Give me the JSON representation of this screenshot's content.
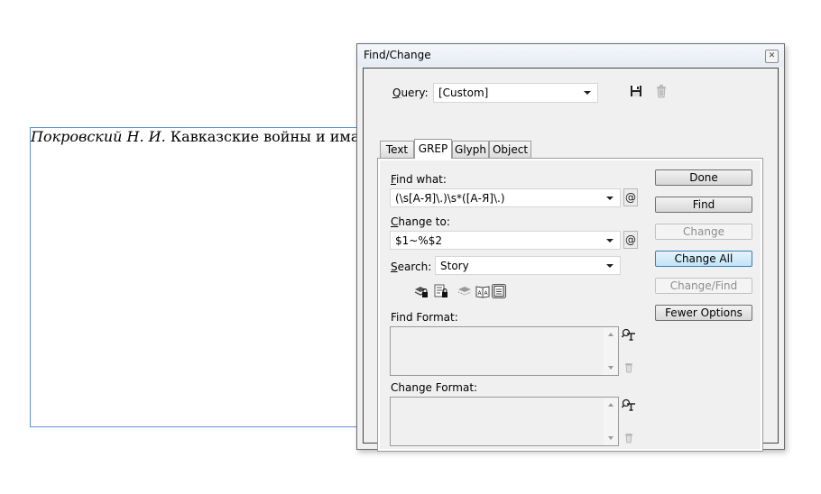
{
  "document": {
    "text_italic": "Покровский Н. И.",
    "text_regular": " Кавказские войны и имам"
  },
  "dialog": {
    "title": "Find/Change",
    "close_icon": "close-icon",
    "query": {
      "label_u": "Q",
      "label_rest": "uery:",
      "value": "[Custom]",
      "save_icon": "floppy-disk-icon",
      "delete_icon": "trash-icon"
    },
    "tabs": [
      {
        "label": "Text",
        "active": false
      },
      {
        "label": "GREP",
        "active": true
      },
      {
        "label": "Glyph",
        "active": false
      },
      {
        "label": "Object",
        "active": false
      }
    ],
    "find_what": {
      "label_u": "F",
      "label_rest": "ind what:",
      "value": "(\\s[А-Я]\\.)\\s*([А-Я]\\.)",
      "special_icon": "@"
    },
    "change_to": {
      "label_u": "C",
      "label_rest": "hange to:",
      "value": "$1~%$2",
      "special_icon": "@"
    },
    "search": {
      "label_u": "S",
      "label_rest": "earch:",
      "value": "Story"
    },
    "options_icons": [
      "include-locked-layers-icon",
      "include-locked-stories-icon",
      "include-hidden-layers-icon",
      "include-master-pages-icon",
      "include-footnotes-icon"
    ],
    "find_format_label": "Find Format:",
    "change_format_label": "Change Format:",
    "buttons": {
      "done": "Done",
      "find": "Find",
      "change": "Change",
      "change_all": "Change All",
      "change_find": "Change/Find",
      "fewer_options": "Fewer Options"
    }
  }
}
